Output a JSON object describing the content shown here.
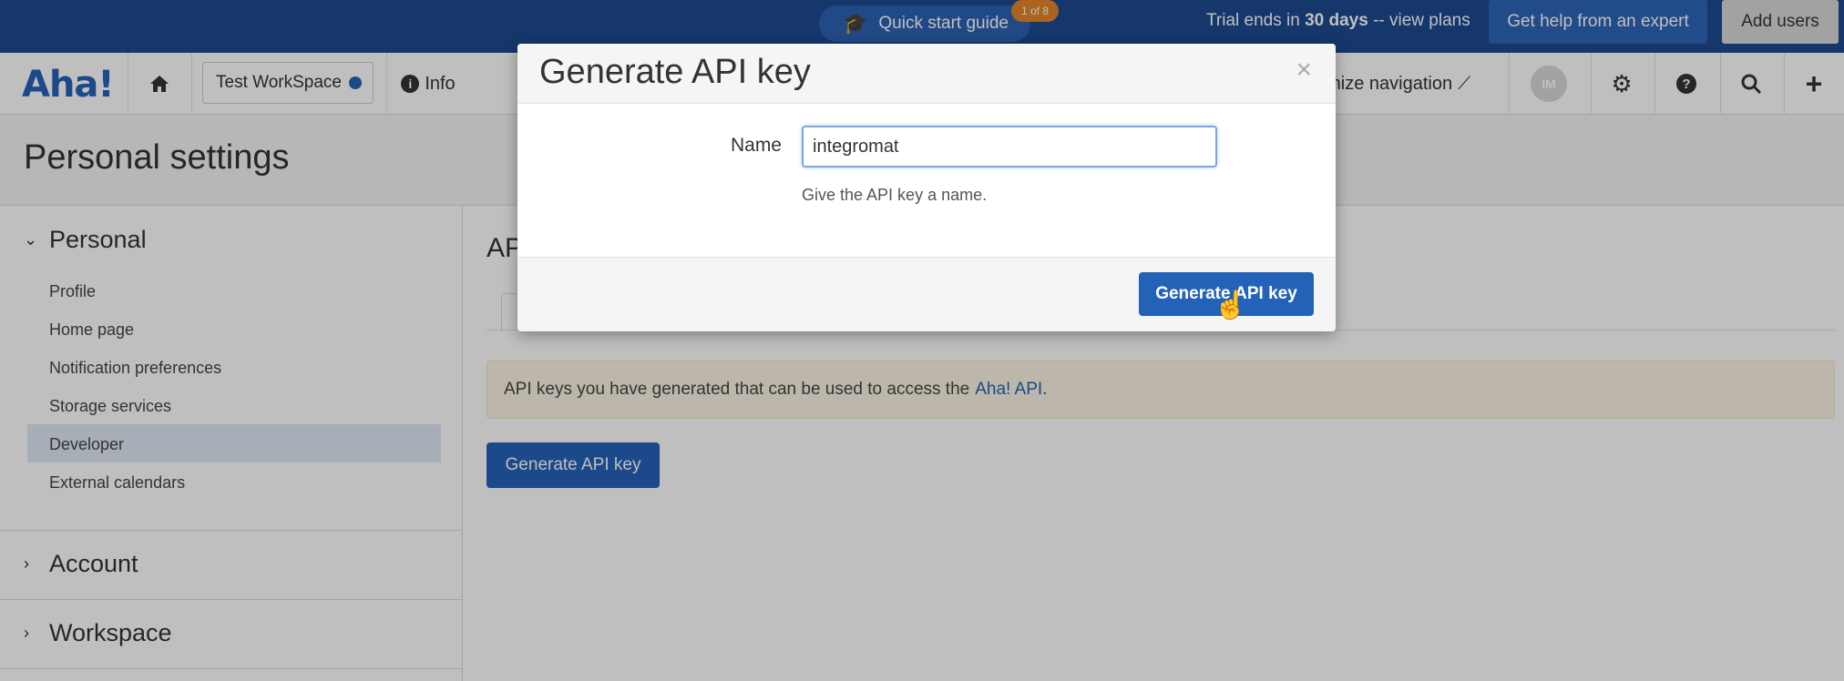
{
  "topbar": {
    "quick_start": "Quick start guide",
    "quick_start_badge": "1 of 8",
    "trial_prefix": "Trial ends in ",
    "trial_days": "30 days",
    "trial_suffix": " -- view plans",
    "expert_button": "Get help from an expert",
    "add_users_button": "Add users"
  },
  "nav": {
    "logo": "Aha!",
    "workspace": "Test WorkSpace",
    "info": "Info",
    "customize": "omize navigation",
    "avatar_initials": "IM"
  },
  "page": {
    "title": "Personal settings"
  },
  "sidebar": {
    "personal": "Personal",
    "items": [
      "Profile",
      "Home page",
      "Notification preferences",
      "Storage services",
      "Developer",
      "External calendars"
    ],
    "account": "Account",
    "workspace": "Workspace"
  },
  "main": {
    "title": "AP",
    "info_text": "API keys you have generated that can be used to access the",
    "info_link": "Aha! API",
    "info_period": ".",
    "generate_button": "Generate API key"
  },
  "modal": {
    "title": "Generate API key",
    "close": "×",
    "name_label": "Name",
    "name_value": "integromat",
    "hint": "Give the API key a name.",
    "submit": "Generate API key"
  }
}
